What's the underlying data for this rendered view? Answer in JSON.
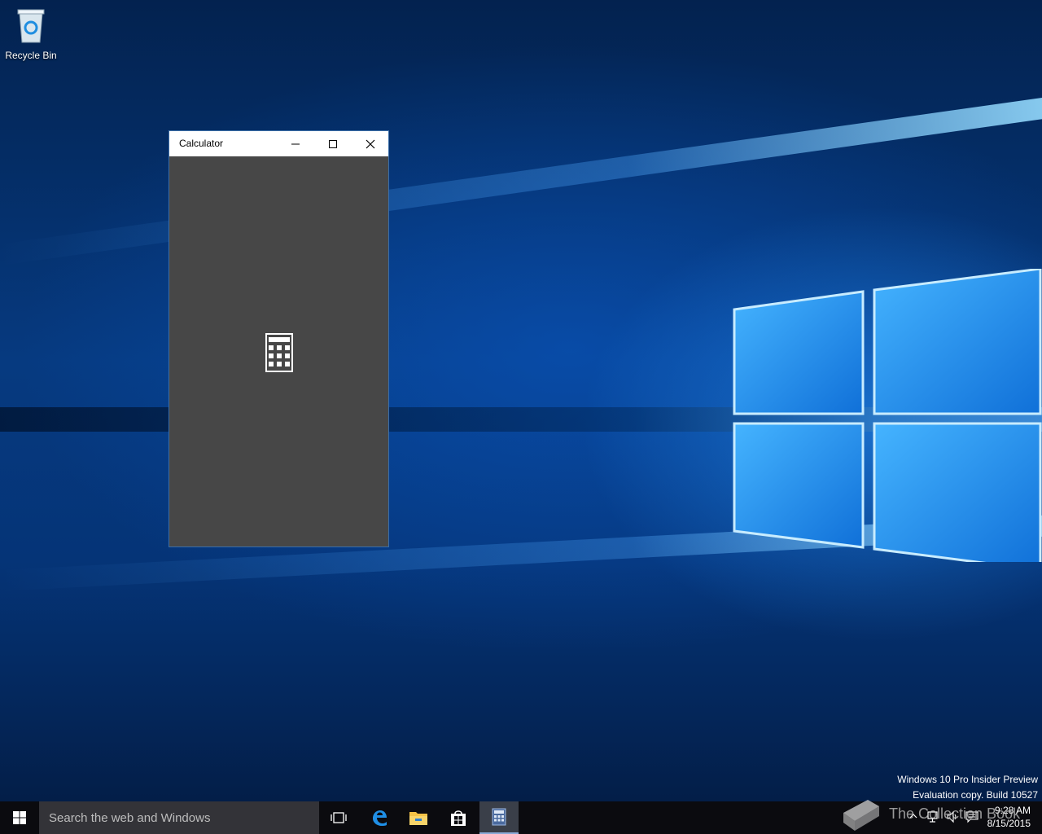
{
  "desktop": {
    "icons": [
      {
        "label": "Recycle Bin",
        "icon": "recycle-bin-icon"
      }
    ]
  },
  "window": {
    "title": "Calculator",
    "splash_icon": "calculator-icon",
    "controls": {
      "minimize": "minimize-icon",
      "maximize": "maximize-icon",
      "close": "close-icon"
    }
  },
  "watermark": {
    "line1": "Windows 10 Pro Insider Preview",
    "line2": "Evaluation copy. Build 10527"
  },
  "taskbar": {
    "search_placeholder": "Search the web and Windows",
    "apps": [
      "task-view-icon",
      "edge-icon",
      "file-explorer-icon",
      "store-icon",
      "calculator-icon"
    ],
    "clock": {
      "time": "9:28 AM",
      "date": "8/15/2015"
    }
  },
  "overlay_logo": {
    "text": "The Collection Book"
  },
  "colors": {
    "accent": "#1e78d7",
    "window_body": "#474747",
    "taskbar": "#0b0b0f",
    "search_box": "#333338"
  }
}
